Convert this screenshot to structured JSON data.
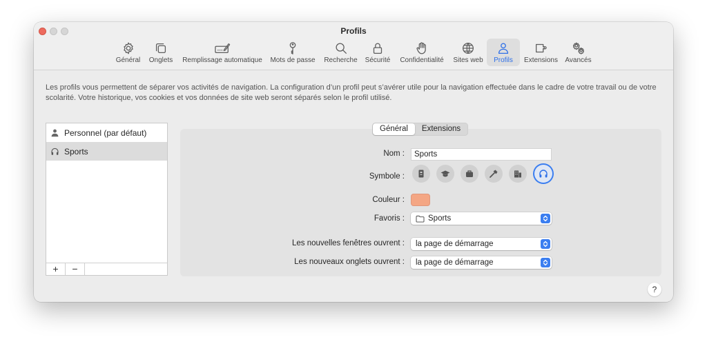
{
  "window": {
    "title": "Profils"
  },
  "tabs": [
    {
      "label": "Général",
      "icon": "gear-icon"
    },
    {
      "label": "Onglets",
      "icon": "tabs-icon"
    },
    {
      "label": "Remplissage automatique",
      "icon": "autofill-pencil-icon"
    },
    {
      "label": "Mots de passe",
      "icon": "key-icon"
    },
    {
      "label": "Recherche",
      "icon": "search-icon"
    },
    {
      "label": "Sécurité",
      "icon": "lock-icon"
    },
    {
      "label": "Confidentialité",
      "icon": "hand-icon"
    },
    {
      "label": "Sites web",
      "icon": "globe-icon"
    },
    {
      "label": "Profils",
      "icon": "person-icon",
      "active": true
    },
    {
      "label": "Extensions",
      "icon": "puzzle-icon"
    },
    {
      "label": "Avancés",
      "icon": "gears-icon"
    }
  ],
  "description": "Les profils vous permettent de séparer vos activités de navigation. La configuration d’un profil peut s’avérer utile pour la navigation effectuée dans le cadre de votre travail ou de votre scolarité. Votre historique, vos cookies et vos données de site web seront séparés selon le profil utilisé.",
  "profiles": [
    {
      "name": "Personnel (par défaut)",
      "icon": "person-icon",
      "selected": false
    },
    {
      "name": "Sports",
      "icon": "headphones-icon",
      "selected": true
    }
  ],
  "sidebar_footer": {
    "add": "+",
    "remove": "−"
  },
  "segments": {
    "general": "Général",
    "extensions": "Extensions"
  },
  "form": {
    "name_label": "Nom :",
    "name_value": "Sports",
    "symbol_label": "Symbole :",
    "symbols": [
      "id-badge-icon",
      "graduation-cap-icon",
      "briefcase-icon",
      "hammer-icon",
      "building-icon",
      "headphones-icon"
    ],
    "selected_symbol": "headphones-icon",
    "color_label": "Couleur :",
    "color_value": "#f4a684",
    "favorites_label": "Favoris :",
    "favorites_value": "Sports",
    "new_windows_label": "Les nouvelles fenêtres ouvrent :",
    "new_windows_value": "la page de démarrage",
    "new_tabs_label": "Les nouveaux onglets ouvrent :",
    "new_tabs_value": "la page de démarrage"
  },
  "help": {
    "label": "?"
  },
  "colors": {
    "accent": "#2d6fe8",
    "close": "#ed6a5e"
  }
}
